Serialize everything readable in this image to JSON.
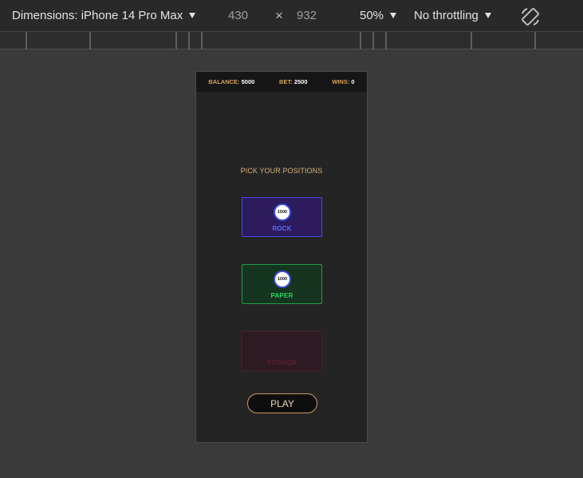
{
  "devtools": {
    "device_label": "Dimensions: iPhone 14 Pro Max",
    "width_value": "430",
    "times_symbol": "×",
    "height_value": "932",
    "zoom": "50%",
    "throttling": "No throttling",
    "rotate_icon": "rotate-device-icon"
  },
  "hud": {
    "balance_label": "BALANCE:",
    "balance_value": "5000",
    "bet_label": "BET:",
    "bet_value": "2500",
    "wins_label": "WINS:",
    "wins_value": "0"
  },
  "game": {
    "heading": "PICK YOUR POSITIONS",
    "positions": [
      {
        "label": "ROCK",
        "chip": "1500",
        "color": "#5b6cff"
      },
      {
        "label": "PAPER",
        "chip": "1000",
        "color": "#2bd565"
      },
      {
        "label": "SCISSOR",
        "chip": "",
        "color": "#5e1f30"
      }
    ],
    "play_label": "PLAY"
  }
}
